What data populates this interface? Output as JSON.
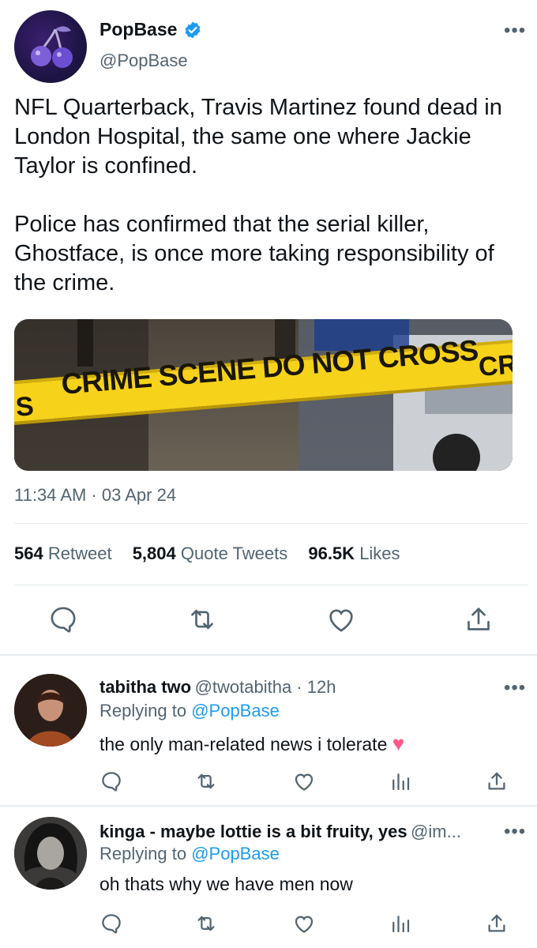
{
  "tweet": {
    "author_name": "PopBase",
    "author_handle": "@PopBase",
    "text": "NFL Quarterback, Travis Martinez found dead in London Hospital, the same one where Jackie Taylor is confined.\n\nPolice has confirmed that the serial killer, Ghostface, is once more taking responsibility of the crime.",
    "media_text_main": "CRIME SCENE DO NOT CROSS",
    "media_text_left": "S",
    "media_text_right": "CR",
    "timestamp": "11:34 AM · 03 Apr 24",
    "stats": {
      "retweets_count": "564",
      "retweets_label": "Retweet",
      "quotes_count": "5,804",
      "quotes_label": "Quote Tweets",
      "likes_count": "96.5K",
      "likes_label": "Likes"
    },
    "more_label": "•••"
  },
  "replies": [
    {
      "name": "tabitha two",
      "handle": "@twotabitha · 12h",
      "replying_prefix": "Replying to",
      "replying_to": "@PopBase",
      "text": "the only man-related news i tolerate",
      "emoji": "♥",
      "more_label": "•••"
    },
    {
      "name": "kinga - maybe lottie is a bit fruity, yes",
      "handle": "@im...",
      "replying_prefix": "Replying to",
      "replying_to": "@PopBase",
      "text": "oh thats why we have men now",
      "more_label": "•••"
    }
  ],
  "colors": {
    "accent": "#1d9bf0",
    "secondary_text": "#536471",
    "tape_yellow": "#f6d21a"
  }
}
